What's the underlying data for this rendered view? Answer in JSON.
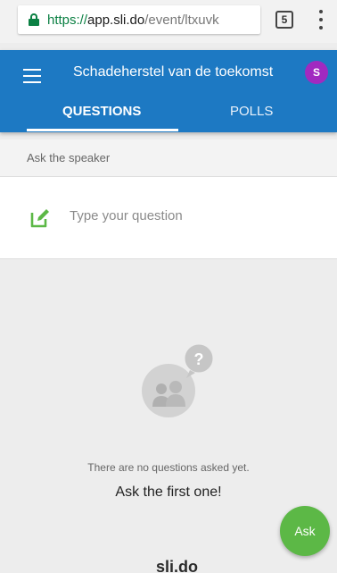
{
  "browser": {
    "url_scheme": "https://",
    "url_host": "app.sli.do",
    "url_path": "/event/ltxuvk",
    "tab_count": "5"
  },
  "header": {
    "event_title": "Schadeherstel van de toekomst",
    "avatar_initial": "S",
    "tabs": [
      {
        "label": "QUESTIONS",
        "active": true
      },
      {
        "label": "POLLS",
        "active": false
      }
    ]
  },
  "section_label": "Ask the speaker",
  "question_input": {
    "placeholder": "Type your question"
  },
  "empty_state": {
    "message": "There are no questions asked yet.",
    "cta": "Ask the first one!",
    "bubble_symbol": "?"
  },
  "brand": "sli.do",
  "fab": {
    "label": "Ask"
  },
  "colors": {
    "header": "#1d79c3",
    "accent_green": "#5cb846",
    "avatar": "#a12ac0",
    "secure_green": "#0b8043"
  },
  "icons": [
    "lock-icon",
    "kebab-menu-icon",
    "hamburger-icon",
    "compose-icon",
    "speaker-question-icon"
  ]
}
